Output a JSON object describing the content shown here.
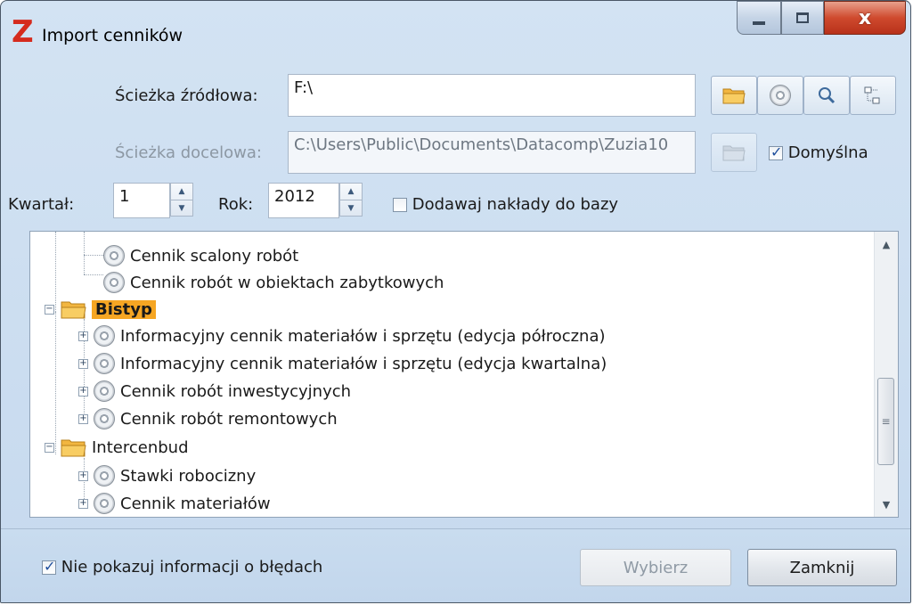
{
  "window": {
    "title": "Import cenników",
    "logo_letter": "Z",
    "close_glyph": "x"
  },
  "source": {
    "label": "Ścieżka źródłowa:",
    "value": "F:\\"
  },
  "target": {
    "label": "Ścieżka docelowa:",
    "value": "C:\\Users\\Public\\Documents\\Datacomp\\Zuzia10",
    "default_label": "Domyślna",
    "default_checked": true
  },
  "quarter": {
    "label": "Kwartał:",
    "value": "1"
  },
  "year": {
    "label": "Rok:",
    "value": "2012"
  },
  "add_outlays": {
    "label": "Dodawaj nakłady do bazy",
    "checked": false
  },
  "tree": {
    "items": [
      {
        "label": "Cennik scalony robót",
        "level": 2,
        "icon": "disc-icon",
        "expander": "",
        "bold": false
      },
      {
        "label": "Cennik robót w obiektach zabytkowych",
        "level": 2,
        "icon": "disc-icon",
        "expander": "",
        "bold": false
      },
      {
        "label": "Bistyp",
        "level": 1,
        "icon": "folder-icon",
        "expander": "−",
        "bold": true
      },
      {
        "label": "Informacyjny cennik materiałów i sprzętu (edycja półroczna)",
        "level": 2,
        "icon": "disc-icon",
        "expander": "+",
        "bold": false
      },
      {
        "label": "Informacyjny cennik materiałów i sprzętu (edycja kwartalna)",
        "level": 2,
        "icon": "disc-icon",
        "expander": "+",
        "bold": false
      },
      {
        "label": "Cennik robót inwestycyjnych",
        "level": 2,
        "icon": "disc-icon",
        "expander": "+",
        "bold": false
      },
      {
        "label": "Cennik robót remontowych",
        "level": 2,
        "icon": "disc-icon",
        "expander": "+",
        "bold": false
      },
      {
        "label": "Intercenbud",
        "level": 1,
        "icon": "folder-icon",
        "expander": "−",
        "bold": false
      },
      {
        "label": "Stawki robocizny",
        "level": 2,
        "icon": "disc-icon",
        "expander": "+",
        "bold": false
      },
      {
        "label": "Cennik materiałów",
        "level": 2,
        "icon": "disc-icon",
        "expander": "+",
        "bold": false
      }
    ]
  },
  "footer": {
    "hide_errors_label": "Nie pokazuj informacji o błędach",
    "hide_errors_checked": true,
    "select_label": "Wybierz",
    "close_label": "Zamknij"
  },
  "colors": {
    "window_bg": "#c9dcef",
    "selection": "#f6a623",
    "logo": "#d52b1e",
    "close_button": "#cf4a2e"
  }
}
